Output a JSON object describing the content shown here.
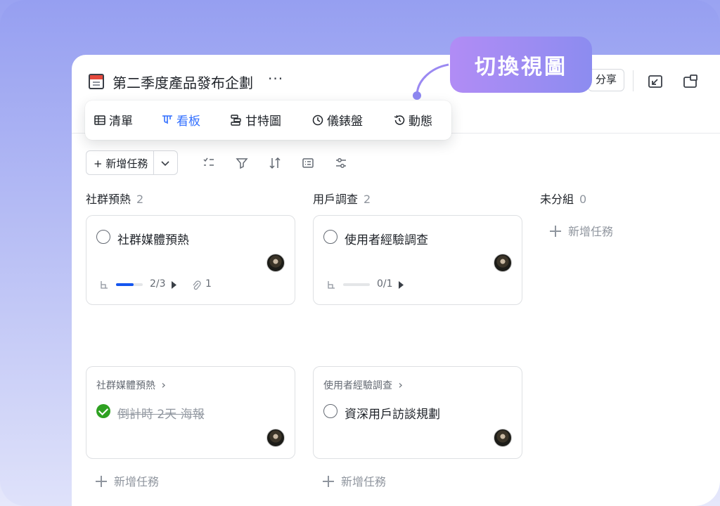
{
  "doc": {
    "title": "第二季度產品發布企劃",
    "more": "···"
  },
  "header": {
    "share_label": "分享"
  },
  "callout": {
    "text": "切換視圖"
  },
  "views": [
    {
      "label": "清單",
      "icon": "table-icon"
    },
    {
      "label": "看板",
      "icon": "kanban-icon",
      "active": true
    },
    {
      "label": "甘特圖",
      "icon": "gantt-icon"
    },
    {
      "label": "儀錶盤",
      "icon": "dashboard-icon"
    },
    {
      "label": "動態",
      "icon": "activity-icon"
    }
  ],
  "toolbar": {
    "add_task_label": "+ 新增任務"
  },
  "columns": [
    {
      "name": "社群預熱",
      "count": "2",
      "cards": [
        {
          "title": "社群媒體預熱",
          "subtask_progress": "2/3",
          "progress_fraction": 0.67,
          "attachments": "1"
        },
        {
          "parent": "社群媒體預熱",
          "parent_arrow": "›",
          "title": "倒計時 2天 海報",
          "done": true
        }
      ],
      "add_label": "新增任務"
    },
    {
      "name": "用戶調查",
      "count": "2",
      "cards": [
        {
          "title": "使用者經驗調查",
          "subtask_progress": "0/1",
          "progress_fraction": 0
        },
        {
          "parent": "使用者經驗調查",
          "parent_arrow": "›",
          "title": "資深用戶訪談規劃",
          "done": false
        }
      ],
      "add_label": "新增任務"
    },
    {
      "name": "未分組",
      "count": "0",
      "add_label": "新增任務"
    }
  ],
  "colors": {
    "accent": "#3370ff",
    "progress": "#1456f0",
    "done": "#2ea121",
    "callout_start": "#b18cf5",
    "callout_end": "#8c8cf0"
  }
}
